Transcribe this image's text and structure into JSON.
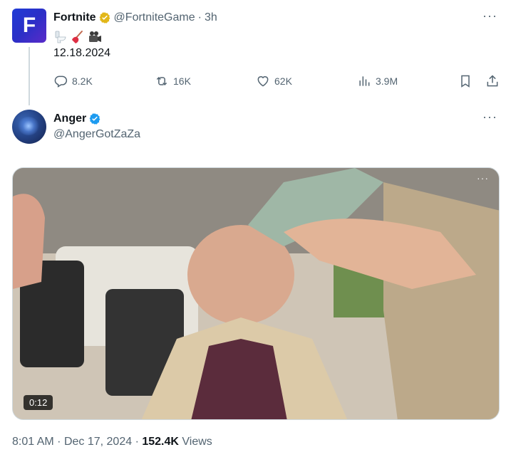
{
  "parent_tweet": {
    "avatar_letter": "F",
    "display_name": "Fortnite",
    "verified_badge": "gold-check-badge",
    "handle": "@FortniteGame",
    "separator": "·",
    "time": "3h",
    "emojis": [
      "toilet-emoji",
      "plunger-emoji",
      "movie-camera-emoji"
    ],
    "text": "12.18.2024",
    "actions": {
      "replies": "8.2K",
      "retweets": "16K",
      "likes": "62K",
      "views": "3.9M"
    },
    "more": "···"
  },
  "reply_tweet": {
    "display_name": "Anger",
    "verified_badge": "blue-check-badge",
    "handle": "@AngerGotZaZa",
    "more": "···",
    "media": {
      "type": "video",
      "duration": "0:12",
      "more": "···"
    }
  },
  "footer": {
    "time": "8:01 AM",
    "sep1": "·",
    "date": "Dec 17, 2024",
    "sep2": "·",
    "views_count": "152.4K",
    "views_label": "Views"
  },
  "colors": {
    "text_primary": "#0f1419",
    "text_secondary": "#536471",
    "verified_blue": "#1d9bf0",
    "verified_gold": "#e2b719",
    "thread_line": "#cfd9de"
  }
}
